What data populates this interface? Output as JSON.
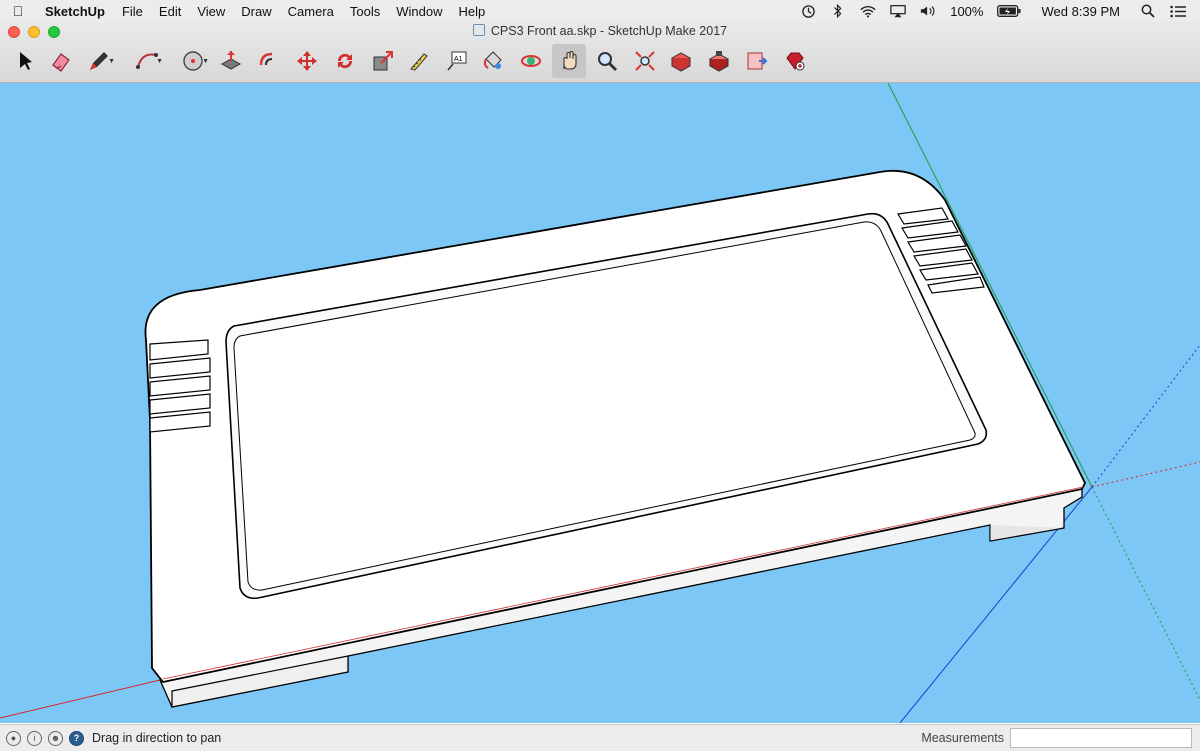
{
  "menubar": {
    "app_name": "SketchUp",
    "menus": [
      "File",
      "Edit",
      "View",
      "Draw",
      "Camera",
      "Tools",
      "Window",
      "Help"
    ],
    "battery": "100%",
    "clock": "Wed 8:39 PM"
  },
  "window": {
    "title": "CPS3 Front aa.skp - SketchUp Make 2017"
  },
  "toolbar": {
    "tools": [
      {
        "name": "select",
        "icon": "arrow-cursor-icon",
        "active": false,
        "dropdown": false
      },
      {
        "name": "eraser",
        "icon": "eraser-icon",
        "active": false,
        "dropdown": false
      },
      {
        "name": "line",
        "icon": "pencil-icon",
        "active": false,
        "dropdown": true
      },
      {
        "name": "arc",
        "icon": "arc-icon",
        "active": false,
        "dropdown": true
      },
      {
        "name": "shapes",
        "icon": "circle-shape-icon",
        "active": false,
        "dropdown": true
      },
      {
        "name": "push-pull",
        "icon": "push-pull-icon",
        "active": false,
        "dropdown": false
      },
      {
        "name": "offset",
        "icon": "offset-icon",
        "active": false,
        "dropdown": false
      },
      {
        "name": "move",
        "icon": "move-icon",
        "active": false,
        "dropdown": false
      },
      {
        "name": "rotate",
        "icon": "rotate-icon",
        "active": false,
        "dropdown": false
      },
      {
        "name": "scale",
        "icon": "scale-icon",
        "active": false,
        "dropdown": false
      },
      {
        "name": "tape-measure",
        "icon": "tape-measure-icon",
        "active": false,
        "dropdown": false
      },
      {
        "name": "text",
        "icon": "text-icon",
        "active": false,
        "dropdown": false
      },
      {
        "name": "paint-bucket",
        "icon": "paint-bucket-icon",
        "active": false,
        "dropdown": false
      },
      {
        "name": "orbit",
        "icon": "orbit-icon",
        "active": false,
        "dropdown": false
      },
      {
        "name": "pan",
        "icon": "hand-pan-icon",
        "active": true,
        "dropdown": false
      },
      {
        "name": "zoom",
        "icon": "magnifier-icon",
        "active": false,
        "dropdown": false
      },
      {
        "name": "zoom-extents",
        "icon": "zoom-extents-icon",
        "active": false,
        "dropdown": false
      },
      {
        "name": "3d-warehouse",
        "icon": "warehouse-icon",
        "active": false,
        "dropdown": false
      },
      {
        "name": "extension-warehouse",
        "icon": "extension-warehouse-icon",
        "active": false,
        "dropdown": false
      },
      {
        "name": "send-to-layout",
        "icon": "layout-icon",
        "active": false,
        "dropdown": false
      },
      {
        "name": "extension-manager",
        "icon": "ruby-gem-icon",
        "active": false,
        "dropdown": false
      }
    ]
  },
  "viewport": {
    "background": "#7cc7f5",
    "axis_colors": {
      "red": "#d62a2a",
      "green": "#1f9c3a",
      "blue": "#1b3fd1"
    }
  },
  "statusbar": {
    "hint": "Drag in direction to pan",
    "measurements_label": "Measurements",
    "measurements_value": ""
  }
}
